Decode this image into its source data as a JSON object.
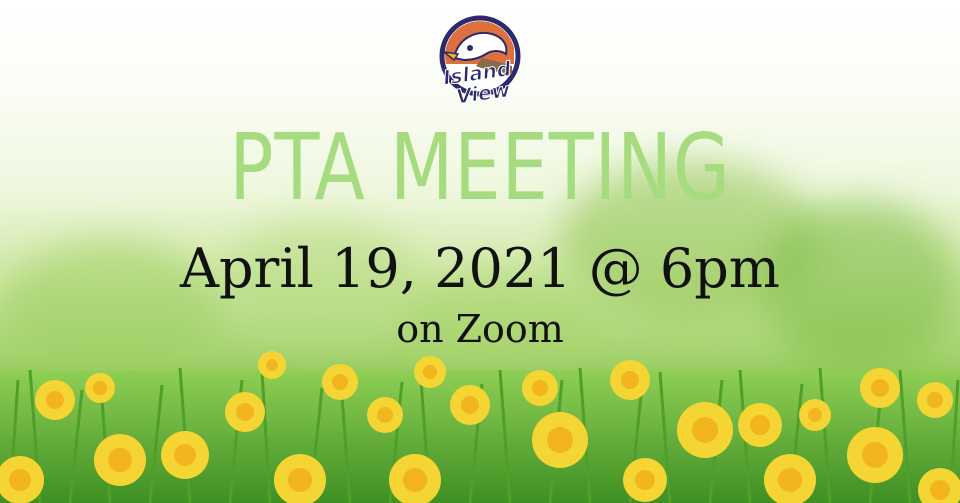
{
  "logo": {
    "line1": "Island",
    "line2": "View"
  },
  "headline": "PTA MEETING",
  "date_time": "April 19, 2021 @ 6pm",
  "location": "on Zoom",
  "colors": {
    "headline": "#a6dc7f",
    "text": "#111111",
    "logo_navy": "#2c2a6b",
    "logo_orange": "#d9602a",
    "daffodil": "#f5d533",
    "daffodil_center": "#f2b51d",
    "grass": "#5aa52f"
  }
}
